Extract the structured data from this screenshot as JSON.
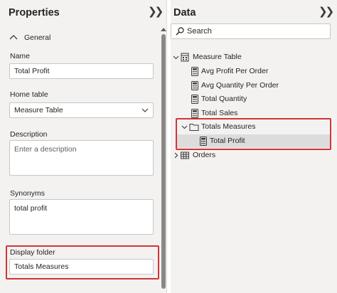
{
  "properties": {
    "title": "Properties",
    "collapse_icon": "double-chevron-right",
    "section": {
      "label": "General",
      "expanded": true
    },
    "name": {
      "label": "Name",
      "value": "Total Profit"
    },
    "home_table": {
      "label": "Home table",
      "value": "Measure Table"
    },
    "description": {
      "label": "Description",
      "placeholder": "Enter a description"
    },
    "synonyms": {
      "label": "Synonyms",
      "value": "total profit"
    },
    "display_folder": {
      "label": "Display folder",
      "value": "Totals Measures"
    }
  },
  "data": {
    "title": "Data",
    "collapse_icon": "double-chevron-right",
    "search": {
      "placeholder": "Search"
    },
    "tree": {
      "measure_table": {
        "label": "Measure Table",
        "items": [
          "Avg Profit Per Order",
          "Avg Quantity Per Order",
          "Total Quantity",
          "Total Sales"
        ]
      },
      "folder": {
        "label": "Totals Measures",
        "items": [
          "Total Profit"
        ]
      },
      "orders": {
        "label": "Orders"
      }
    }
  },
  "colors": {
    "highlight": "#d13438",
    "pane_background": "#f3f2f1",
    "selected_row": "#dcdcdc",
    "scroll_thumb": "#8a8886"
  }
}
